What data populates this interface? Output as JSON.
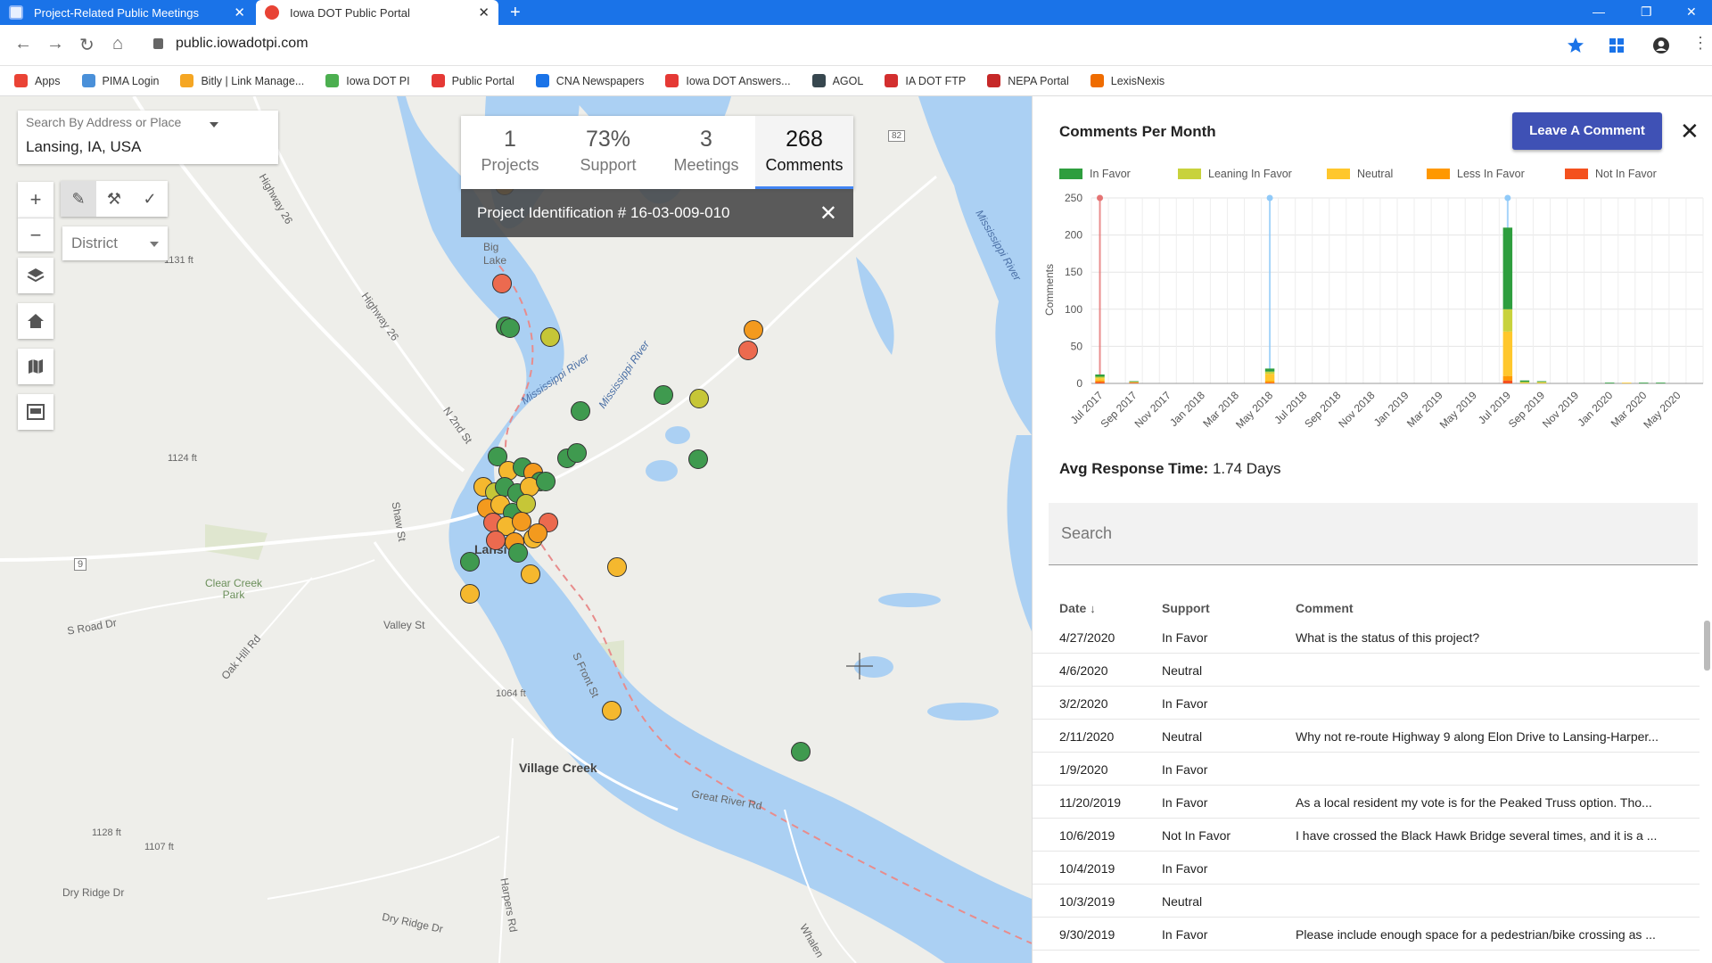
{
  "browser": {
    "tabs": [
      {
        "label": "Project-Related Public Meetings",
        "active": false
      },
      {
        "label": "Iowa DOT Public Portal",
        "active": true
      }
    ],
    "url": "public.iowadotpi.com",
    "bookmarks": [
      "Apps",
      "PIMA Login",
      "Bitly | Link Manage...",
      "Iowa DOT PI",
      "Public Portal",
      "CNA Newspapers",
      "Iowa DOT Answers...",
      "AGOL",
      "IA DOT FTP",
      "NEPA Portal",
      "LexisNexis"
    ],
    "bookmark_colors": [
      "#ea4335",
      "#4a90d9",
      "#f5a623",
      "#4caf50",
      "#e53935",
      "#1a73e8",
      "#e53935",
      "#37474f",
      "#d32f2f",
      "#c62828",
      "#ef6c00"
    ]
  },
  "map": {
    "search_label": "Search By Address or Place",
    "search_value": "Lansing, IA, USA",
    "district_label": "District",
    "labels": {
      "big_lake": "Big\nLake",
      "mississippi_1": "Mississippi River",
      "mississippi_2": "Mississippi River",
      "mississippi_3": "Mississippi River",
      "lansing": "Lansi",
      "village_creek": "Village Creek",
      "clear_creek": "Clear Creek\nPark",
      "great_river": "Great River Rd",
      "valley_st": "Valley St",
      "s_road": "S Road Dr",
      "oak_hill": "Oak Hill Rd",
      "dry_ridge_1": "Dry Ridge Dr",
      "dry_ridge_2": "Dry Ridge Dr",
      "shaw_st": "Shaw St",
      "n2nd": "N 2nd St",
      "s_front": "S Front St",
      "hwy26_1": "Highway 26",
      "hwy26_2": "Highway 26",
      "el1131": "1131 ft",
      "el1124": "1124 ft",
      "el1064": "1064 ft",
      "el1128": "1128 ft",
      "el1107": "1107 ft",
      "hwy9": "9",
      "hwy82": "82",
      "harpers": "Harpers Rd",
      "whalen": "Whalen"
    },
    "stats": [
      {
        "num": "1",
        "cap": "Projects"
      },
      {
        "num": "73%",
        "cap": "Support"
      },
      {
        "num": "3",
        "cap": "Meetings"
      },
      {
        "num": "268",
        "cap": "Comments"
      }
    ],
    "project_title": "Project Identification # 16-03-009-010"
  },
  "panel": {
    "title": "Comments Per Month",
    "leave_button": "Leave A Comment",
    "avg_label": "Avg Response Time:",
    "avg_value": "1.74 Days",
    "search_placeholder": "Search",
    "columns": [
      "Date",
      "Support",
      "Comment"
    ],
    "rows": [
      {
        "date": "4/27/2020",
        "support": "In Favor",
        "comment": "What is the status of this project?"
      },
      {
        "date": "4/6/2020",
        "support": "Neutral",
        "comment": ""
      },
      {
        "date": "3/2/2020",
        "support": "In Favor",
        "comment": ""
      },
      {
        "date": "2/11/2020",
        "support": "Neutral",
        "comment": "Why not re-route Highway 9 along Elon Drive to Lansing-Harper..."
      },
      {
        "date": "1/9/2020",
        "support": "In Favor",
        "comment": ""
      },
      {
        "date": "11/20/2019",
        "support": "In Favor",
        "comment": "As a local resident my vote is for the Peaked Truss option. Tho..."
      },
      {
        "date": "10/6/2019",
        "support": "Not In Favor",
        "comment": "I have crossed the Black Hawk Bridge several times, and it is a ..."
      },
      {
        "date": "10/4/2019",
        "support": "In Favor",
        "comment": ""
      },
      {
        "date": "10/3/2019",
        "support": "Neutral",
        "comment": ""
      },
      {
        "date": "9/30/2019",
        "support": "In Favor",
        "comment": "Please include enough space for a pedestrian/bike crossing as ..."
      }
    ]
  },
  "chart_data": {
    "type": "bar",
    "stacked": true,
    "title": "Comments Per Month",
    "ylabel": "Comments",
    "ylim": [
      0,
      250
    ],
    "yticks": [
      0,
      50,
      100,
      150,
      200,
      250
    ],
    "grid": true,
    "legend_position": "top",
    "categories": [
      "Jul 2017",
      "Aug 2017",
      "Sep 2017",
      "Oct 2017",
      "Nov 2017",
      "Dec 2017",
      "Jan 2018",
      "Feb 2018",
      "Mar 2018",
      "Apr 2018",
      "May 2018",
      "Jun 2018",
      "Jul 2018",
      "Aug 2018",
      "Sep 2018",
      "Oct 2018",
      "Nov 2018",
      "Dec 2018",
      "Jan 2019",
      "Feb 2019",
      "Mar 2019",
      "Apr 2019",
      "May 2019",
      "Jun 2019",
      "Jul 2019",
      "Aug 2019",
      "Sep 2019",
      "Oct 2019",
      "Nov 2019",
      "Dec 2019",
      "Jan 2020",
      "Feb 2020",
      "Mar 2020",
      "Apr 2020",
      "May 2020",
      "Jun 2020"
    ],
    "tick_labels": [
      "Jul 2017",
      "Sep 2017",
      "Nov 2017",
      "Jan 2018",
      "Mar 2018",
      "May 2018",
      "Jul 2018",
      "Sep 2018",
      "Nov 2018",
      "Jan 2019",
      "Mar 2019",
      "May 2019",
      "Jul 2019",
      "Sep 2019",
      "Nov 2019",
      "Jan 2020",
      "Mar 2020",
      "May 2020"
    ],
    "series": [
      {
        "name": "In Favor",
        "color": "#2e9e3e",
        "values": [
          3,
          0,
          1,
          0,
          0,
          0,
          0,
          0,
          0,
          0,
          4,
          0,
          0,
          0,
          0,
          0,
          0,
          0,
          0,
          0,
          0,
          0,
          0,
          0,
          110,
          2,
          1,
          0,
          0,
          0,
          1,
          0,
          1,
          1,
          0,
          0
        ]
      },
      {
        "name": "Leaning In Favor",
        "color": "#c8d23c",
        "values": [
          2,
          0,
          0,
          0,
          0,
          0,
          0,
          0,
          0,
          0,
          3,
          0,
          0,
          0,
          0,
          0,
          0,
          0,
          0,
          0,
          0,
          0,
          0,
          0,
          30,
          1,
          1,
          0,
          0,
          0,
          0,
          0,
          0,
          0,
          0,
          0
        ]
      },
      {
        "name": "Neutral",
        "color": "#ffc72c",
        "values": [
          3,
          0,
          1,
          0,
          0,
          0,
          0,
          0,
          0,
          0,
          10,
          0,
          0,
          0,
          0,
          0,
          0,
          0,
          0,
          0,
          0,
          0,
          0,
          0,
          60,
          1,
          1,
          0,
          0,
          0,
          0,
          1,
          0,
          0,
          0,
          0
        ]
      },
      {
        "name": "Less In Favor",
        "color": "#ff9800",
        "values": [
          2,
          0,
          0,
          0,
          0,
          0,
          0,
          0,
          0,
          0,
          2,
          0,
          0,
          0,
          0,
          0,
          0,
          0,
          0,
          0,
          0,
          0,
          0,
          0,
          6,
          0,
          0,
          0,
          0,
          0,
          0,
          0,
          0,
          0,
          0,
          0
        ]
      },
      {
        "name": "Not In Favor",
        "color": "#f4511e",
        "values": [
          2,
          0,
          1,
          0,
          0,
          0,
          0,
          0,
          0,
          0,
          1,
          0,
          0,
          0,
          0,
          0,
          0,
          0,
          0,
          0,
          0,
          0,
          0,
          0,
          4,
          0,
          0,
          0,
          0,
          0,
          0,
          0,
          0,
          0,
          0,
          0
        ]
      }
    ],
    "meeting_markers": [
      {
        "category": "Jul 2017",
        "color": "#e57373"
      },
      {
        "category": "May 2018",
        "color": "#90caf9"
      },
      {
        "category": "Jul 2019",
        "color": "#90caf9"
      }
    ]
  }
}
